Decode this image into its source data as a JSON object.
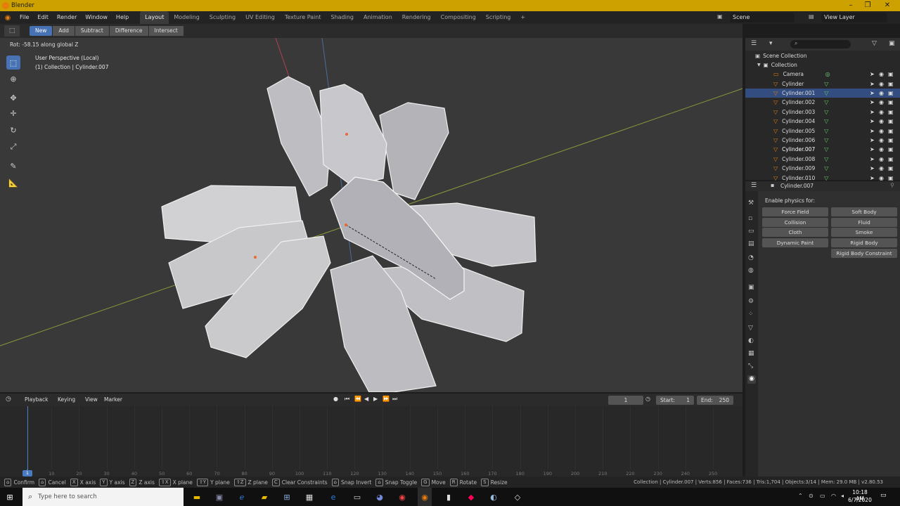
{
  "window": {
    "title": "Blender",
    "min": "–",
    "max": "❐",
    "close": "✕"
  },
  "menu": {
    "items": [
      "File",
      "Edit",
      "Render",
      "Window",
      "Help"
    ]
  },
  "workspaces": [
    "Layout",
    "Modeling",
    "Sculpting",
    "UV Editing",
    "Texture Paint",
    "Shading",
    "Animation",
    "Rendering",
    "Compositing",
    "Scripting",
    "+"
  ],
  "scene": {
    "label": "Scene",
    "view_layer": "View Layer"
  },
  "boolean_tool": {
    "buttons": [
      "New",
      "Add",
      "Subtract",
      "Difference",
      "Intersect"
    ]
  },
  "viewport": {
    "header_text": "Rot: -58.15 along global Z",
    "perspective": "User Perspective (Local)",
    "collection_info": "(1) Collection | Cylinder.007"
  },
  "outliner": {
    "root": "Scene Collection",
    "collection": "Collection",
    "items": [
      "Camera",
      "Cylinder",
      "Cylinder.001",
      "Cylinder.002",
      "Cylinder.003",
      "Cylinder.004",
      "Cylinder.005",
      "Cylinder.006",
      "Cylinder.007",
      "Cylinder.008",
      "Cylinder.009",
      "Cylinder.010"
    ],
    "selected_index": 2,
    "active_index": 8
  },
  "properties": {
    "object_name": "Cylinder.007",
    "section_label": "Enable physics for:",
    "left_buttons": [
      "Force Field",
      "Collision",
      "Cloth",
      "Dynamic Paint"
    ],
    "right_buttons": [
      "Soft Body",
      "Fluid",
      "Smoke",
      "Rigid Body",
      "Rigid Body Constraint"
    ]
  },
  "timeline": {
    "menus": [
      "Playback",
      "Keying",
      "View",
      "Marker"
    ],
    "current_frame": "1",
    "start_label": "Start:",
    "start": "1",
    "end_label": "End:",
    "end": "250",
    "ruler": [
      "1",
      "10",
      "20",
      "30",
      "40",
      "50",
      "60",
      "70",
      "80",
      "90",
      "100",
      "110",
      "120",
      "130",
      "140",
      "150",
      "160",
      "170",
      "180",
      "190",
      "200",
      "210",
      "220",
      "230",
      "240",
      "250"
    ]
  },
  "statusbar": {
    "hints": [
      {
        "key": "⌂",
        "label": "Confirm"
      },
      {
        "key": "⌂",
        "label": "Cancel"
      },
      {
        "key": "X",
        "label": "X axis"
      },
      {
        "key": "Y",
        "label": "Y axis"
      },
      {
        "key": "Z",
        "label": "Z axis"
      },
      {
        "key": "⇧X",
        "label": "X plane"
      },
      {
        "key": "⇧Y",
        "label": "Y plane"
      },
      {
        "key": "⇧Z",
        "label": "Z plane"
      },
      {
        "key": "C",
        "label": "Clear Constraints"
      },
      {
        "key": "⌂",
        "label": "Snap Invert"
      },
      {
        "key": "⌂",
        "label": "Snap Toggle"
      },
      {
        "key": "G",
        "label": "Move"
      },
      {
        "key": "R",
        "label": "Rotate"
      },
      {
        "key": "S",
        "label": "Resize"
      }
    ],
    "info": "Collection | Cylinder.007 | Verts:856 | Faces:736 | Tris:1,704 | Objects:3/14 | Mem: 29.0 MB | v2.80.53"
  },
  "taskbar": {
    "search_placeholder": "Type here to search",
    "time": "10:18 AM",
    "date": "6/7/2020"
  }
}
